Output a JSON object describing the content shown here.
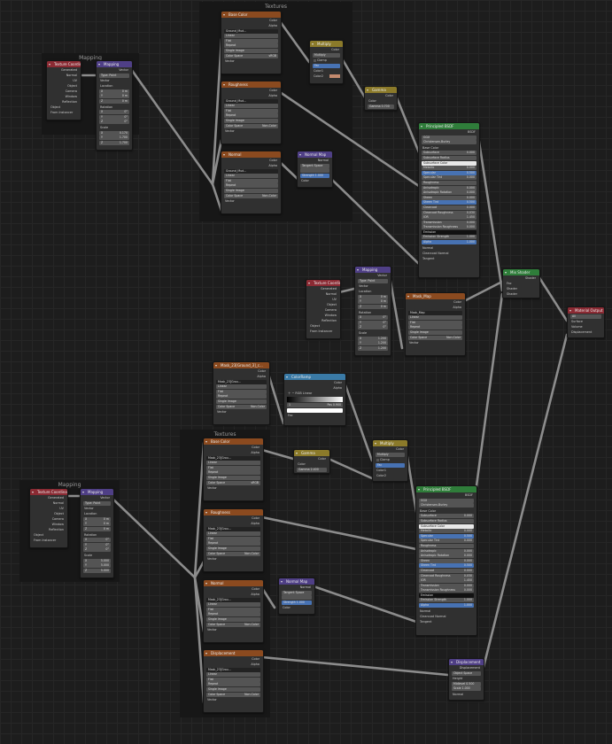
{
  "frames": {
    "mapping_top": "Mapping",
    "textures_top": "Textures",
    "textures_bottom": "Textures",
    "mapping_bottom": "Mapping"
  },
  "labels": {
    "tex_coord": "Texture Coordinate",
    "generated": "Generated",
    "normal": "Normal",
    "uv": "UV",
    "object": "Object",
    "camera": "Camera",
    "window": "Window",
    "reflection": "Reflection",
    "objects": "Object",
    "from_instancer": "From Instancer",
    "mapping": "Mapping",
    "vector": "Vector",
    "type": "Type:",
    "point": "Point",
    "location": "Location",
    "rotation": "Rotation",
    "scale": "Scale",
    "x": "X",
    "y": "Y",
    "z": "Z",
    "color": "Color",
    "alpha": "Alpha",
    "linear": "Linear",
    "flat": "Flat",
    "repeat": "Repeat",
    "single_image": "Single Image",
    "color_space": "Color Space",
    "srgb": "sRGB",
    "non_color": "Non-Color",
    "base_color": "Base Color",
    "roughness": "Roughness",
    "normal_tex": "Normal",
    "multiply": "Multiply",
    "clamp": "Clamp",
    "fac": "Fac",
    "color1": "Color1",
    "color2": "Color2",
    "gamma_node": "Gamma",
    "gamma_val": "Gamma  0.700",
    "normal_map": "Normal Map",
    "tangent_space": "Tangent Space",
    "strength": "Strength  1.000",
    "principled": "Principled BSDF",
    "bsdf": "BSDF",
    "ggx": "GGX",
    "christensen": "Christensen-Burley",
    "mix_shader": "Mix Shader",
    "shader": "Shader",
    "material_output": "Material Output",
    "all": "All",
    "surface": "Surface",
    "volume": "Volume",
    "displacement": "Displacement",
    "colorramp": "ColorRamp",
    "rgb": "RGB",
    "linear_ramp": "Linear",
    "pos": "Pos  0.900",
    "one": "1",
    "gamma_bottom": "Gamma  2.400",
    "displacement_node": "Displacement",
    "object_space": "Object Space",
    "height": "Height",
    "midlevel": "Midlevel  0.500",
    "scale_val": "Scale  1.000",
    "tex_img_top": "Ground_Mud...",
    "tex_img_mid": "Mask_Map",
    "tex_img_single": "Mask_23[Ground_3]_c...",
    "tex_img_bottom": "Mask_23[Grou..."
  },
  "mapping_values": {
    "loc": [
      "0 m",
      "0 m",
      "0 m"
    ],
    "rot": [
      "0°",
      "0°",
      "0°"
    ],
    "scale_top": [
      "0.170",
      "1.700",
      "1.700"
    ],
    "scale_mid": [
      "1.200",
      "1.200",
      "1.200"
    ],
    "scale_bot": [
      "5.000",
      "5.000",
      "5.000"
    ]
  },
  "principled": {
    "rows": [
      [
        "Subsurface",
        "0.000"
      ],
      [
        "Subsurface Radius",
        ""
      ],
      [
        "Subsurface Color",
        ""
      ],
      [
        "Metallic",
        "0.000"
      ],
      [
        "Specular",
        "0.500"
      ],
      [
        "Specular Tint",
        "0.000"
      ],
      [
        "Roughness",
        ""
      ],
      [
        "Anisotropic",
        "0.000"
      ],
      [
        "Anisotropic Rotation",
        "0.000"
      ],
      [
        "Sheen",
        "0.000"
      ],
      [
        "Sheen Tint",
        "0.500"
      ],
      [
        "Clearcoat",
        "0.000"
      ],
      [
        "Clearcoat Roughness",
        "0.030"
      ],
      [
        "IOR",
        "1.450"
      ],
      [
        "Transmission",
        "0.000"
      ],
      [
        "Transmission Roughness",
        "0.000"
      ],
      [
        "Emission",
        ""
      ],
      [
        "Emission Strength",
        "1.000"
      ],
      [
        "Alpha",
        "1.000"
      ]
    ],
    "tail": [
      "Normal",
      "Clearcoat Normal",
      "Tangent"
    ]
  }
}
